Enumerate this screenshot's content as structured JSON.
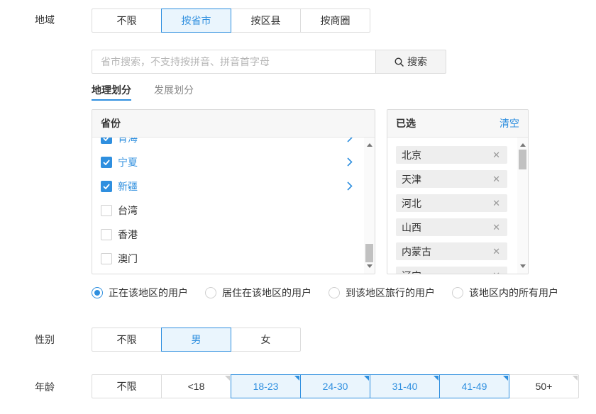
{
  "region": {
    "label": "地域",
    "options": [
      "不限",
      "按省市",
      "按区县",
      "按商圈"
    ],
    "selected": "按省市"
  },
  "search": {
    "placeholder": "省市搜索，不支持按拼音、拼音首字母",
    "button_label": "搜索"
  },
  "subtabs": {
    "active": "地理划分",
    "inactive": "发展划分"
  },
  "province_panel": {
    "header": "省份",
    "items": [
      {
        "name": "青海",
        "checked": true
      },
      {
        "name": "宁夏",
        "checked": true
      },
      {
        "name": "新疆",
        "checked": true
      },
      {
        "name": "台湾",
        "checked": false
      },
      {
        "name": "香港",
        "checked": false
      },
      {
        "name": "澳门",
        "checked": false
      }
    ]
  },
  "selected_panel": {
    "header": "已选",
    "clear_label": "清空",
    "items": [
      "北京",
      "天津",
      "河北",
      "山西",
      "内蒙古",
      "辽宁"
    ]
  },
  "user_scope": {
    "options": [
      "正在该地区的用户",
      "居住在该地区的用户",
      "到该地区旅行的用户",
      "该地区内的所有用户"
    ],
    "selected": "正在该地区的用户"
  },
  "gender": {
    "label": "性别",
    "options": [
      "不限",
      "男",
      "女"
    ],
    "selected": "男"
  },
  "age": {
    "label": "年龄",
    "options": [
      "不限",
      "<18",
      "18-23",
      "24-30",
      "31-40",
      "41-49",
      "50+"
    ],
    "selected": [
      "18-23",
      "24-30",
      "31-40",
      "41-49"
    ]
  },
  "colors": {
    "accent": "#2f8fdf",
    "active_bg": "#eaf5fd"
  }
}
